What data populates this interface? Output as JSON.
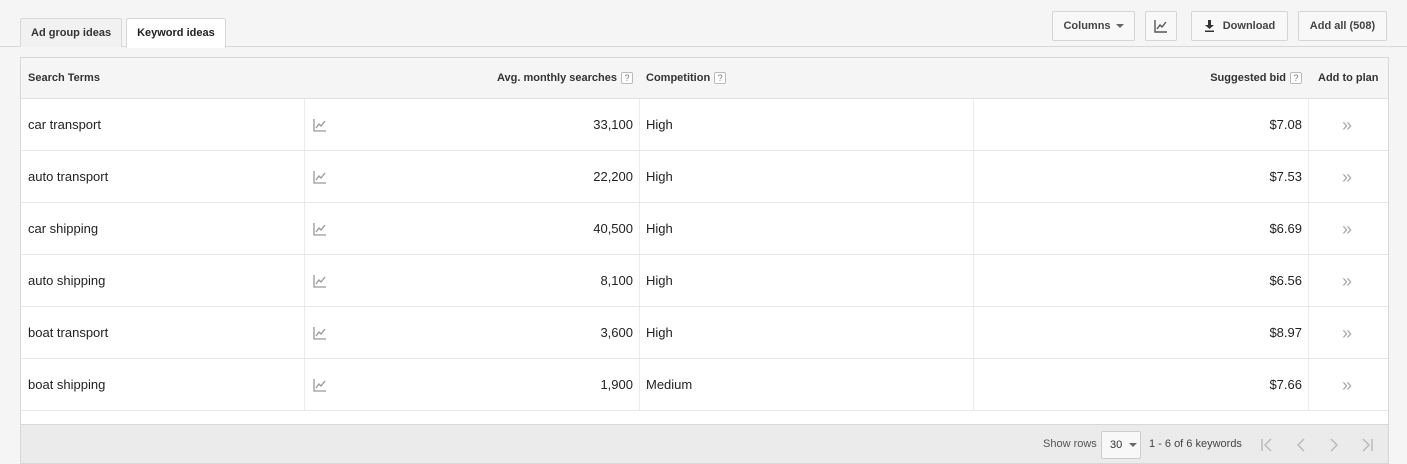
{
  "tabs": [
    {
      "label": "Ad group ideas",
      "active": false
    },
    {
      "label": "Keyword ideas",
      "active": true
    }
  ],
  "toolbar": {
    "columns_label": "Columns",
    "chart_icon": "line-chart-icon",
    "download_label": "Download",
    "download_icon": "download-icon",
    "add_all_label": "Add all (508)"
  },
  "table": {
    "headers": {
      "search_terms": "Search Terms",
      "avg_monthly_searches": "Avg. monthly searches",
      "competition": "Competition",
      "suggested_bid": "Suggested bid",
      "add_to_plan": "Add to plan",
      "help_glyph": "?"
    },
    "rows": [
      {
        "term": "car transport",
        "searches": "33,100",
        "competition": "High",
        "bid": "$7.08"
      },
      {
        "term": "auto transport",
        "searches": "22,200",
        "competition": "High",
        "bid": "$7.53"
      },
      {
        "term": "car shipping",
        "searches": "40,500",
        "competition": "High",
        "bid": "$6.69"
      },
      {
        "term": "auto shipping",
        "searches": "8,100",
        "competition": "High",
        "bid": "$6.56"
      },
      {
        "term": "boat transport",
        "searches": "3,600",
        "competition": "High",
        "bid": "$8.97"
      },
      {
        "term": "boat shipping",
        "searches": "1,900",
        "competition": "Medium",
        "bid": "$7.66"
      }
    ],
    "add_glyph": "»"
  },
  "footer": {
    "show_rows_label": "Show rows",
    "rows_value": "30",
    "range_text": "1 - 6 of 6 keywords"
  },
  "colors": {
    "background": "#f5f5f5",
    "table_bg": "#ffffff",
    "header_bg": "#f5f5f5",
    "border": "#d8d8d8",
    "icon_grey": "#999999"
  }
}
